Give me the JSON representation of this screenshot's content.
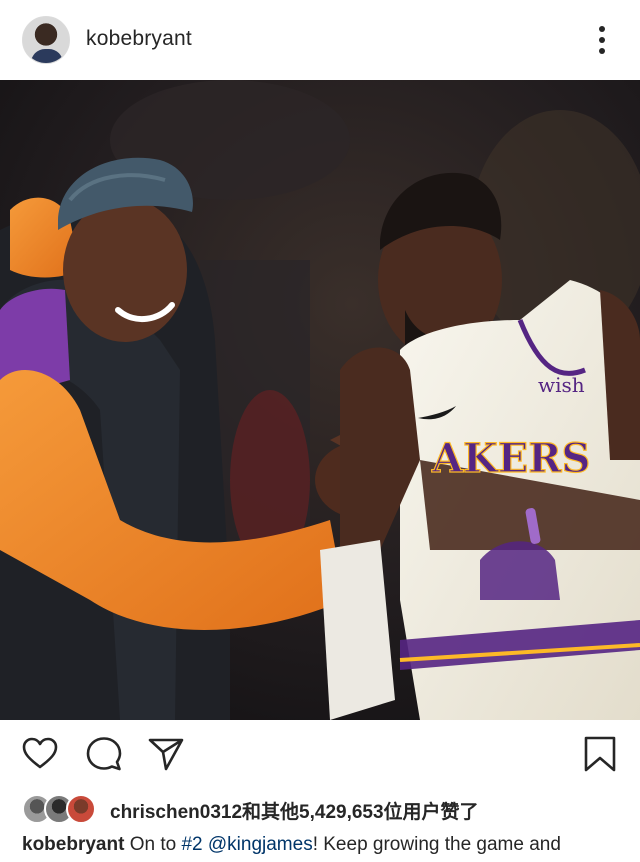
{
  "header": {
    "username": "kobebryant",
    "avatar_icon": "profile-avatar",
    "more_icon": "more-vertical-icon"
  },
  "post": {
    "photo_text": {
      "jersey_sponsor": "wish",
      "jersey_team": "AKERS"
    }
  },
  "actions": {
    "like_icon": "heart-icon",
    "comment_icon": "comment-icon",
    "share_icon": "send-icon",
    "save_icon": "bookmark-icon"
  },
  "likes": {
    "text": "chrischen0312和其他5,429,653位用户赞了"
  },
  "caption": {
    "user": "kobebryant",
    "text_1": " On to ",
    "hashtag": "#2",
    "text_2": " ",
    "mention": "@kingjames",
    "text_3": "! Keep growing the game and"
  },
  "colors": {
    "text": "#262626",
    "link": "#003569",
    "hoodie": "#f08a28",
    "beanie": "#3f5560",
    "jersey": "#f3f0e6",
    "lakers_purple": "#552583",
    "lakers_gold": "#fdb927"
  }
}
